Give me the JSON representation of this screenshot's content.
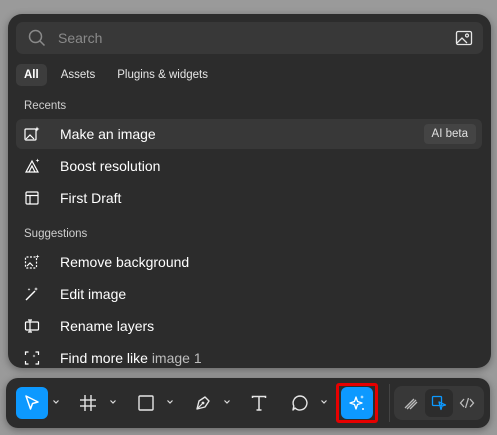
{
  "search": {
    "placeholder": "Search"
  },
  "tabs": [
    {
      "label": "All",
      "active": true
    },
    {
      "label": "Assets",
      "active": false
    },
    {
      "label": "Plugins & widgets",
      "active": false
    }
  ],
  "recents": {
    "title": "Recents",
    "items": [
      {
        "label": "Make an image",
        "icon": "image-sparkle-icon",
        "badge": "AI beta",
        "highlighted": true
      },
      {
        "label": "Boost resolution",
        "icon": "boost-resolution-icon"
      },
      {
        "label": "First Draft",
        "icon": "first-draft-icon"
      }
    ]
  },
  "suggestions": {
    "title": "Suggestions",
    "items": [
      {
        "label": "Remove background",
        "icon": "remove-background-icon"
      },
      {
        "label": "Edit image",
        "icon": "magic-wand-icon"
      },
      {
        "label": "Rename layers",
        "icon": "rename-layers-icon"
      },
      {
        "label": "Find more like",
        "muted": "image 1",
        "icon": "find-similar-icon"
      }
    ]
  },
  "toolbar": {
    "tools": [
      "move",
      "frame",
      "shape",
      "pen",
      "text",
      "comment",
      "actions"
    ],
    "modes": [
      "draw",
      "design",
      "dev"
    ],
    "accent": "#0d99ff",
    "highlight": "#e60000"
  }
}
